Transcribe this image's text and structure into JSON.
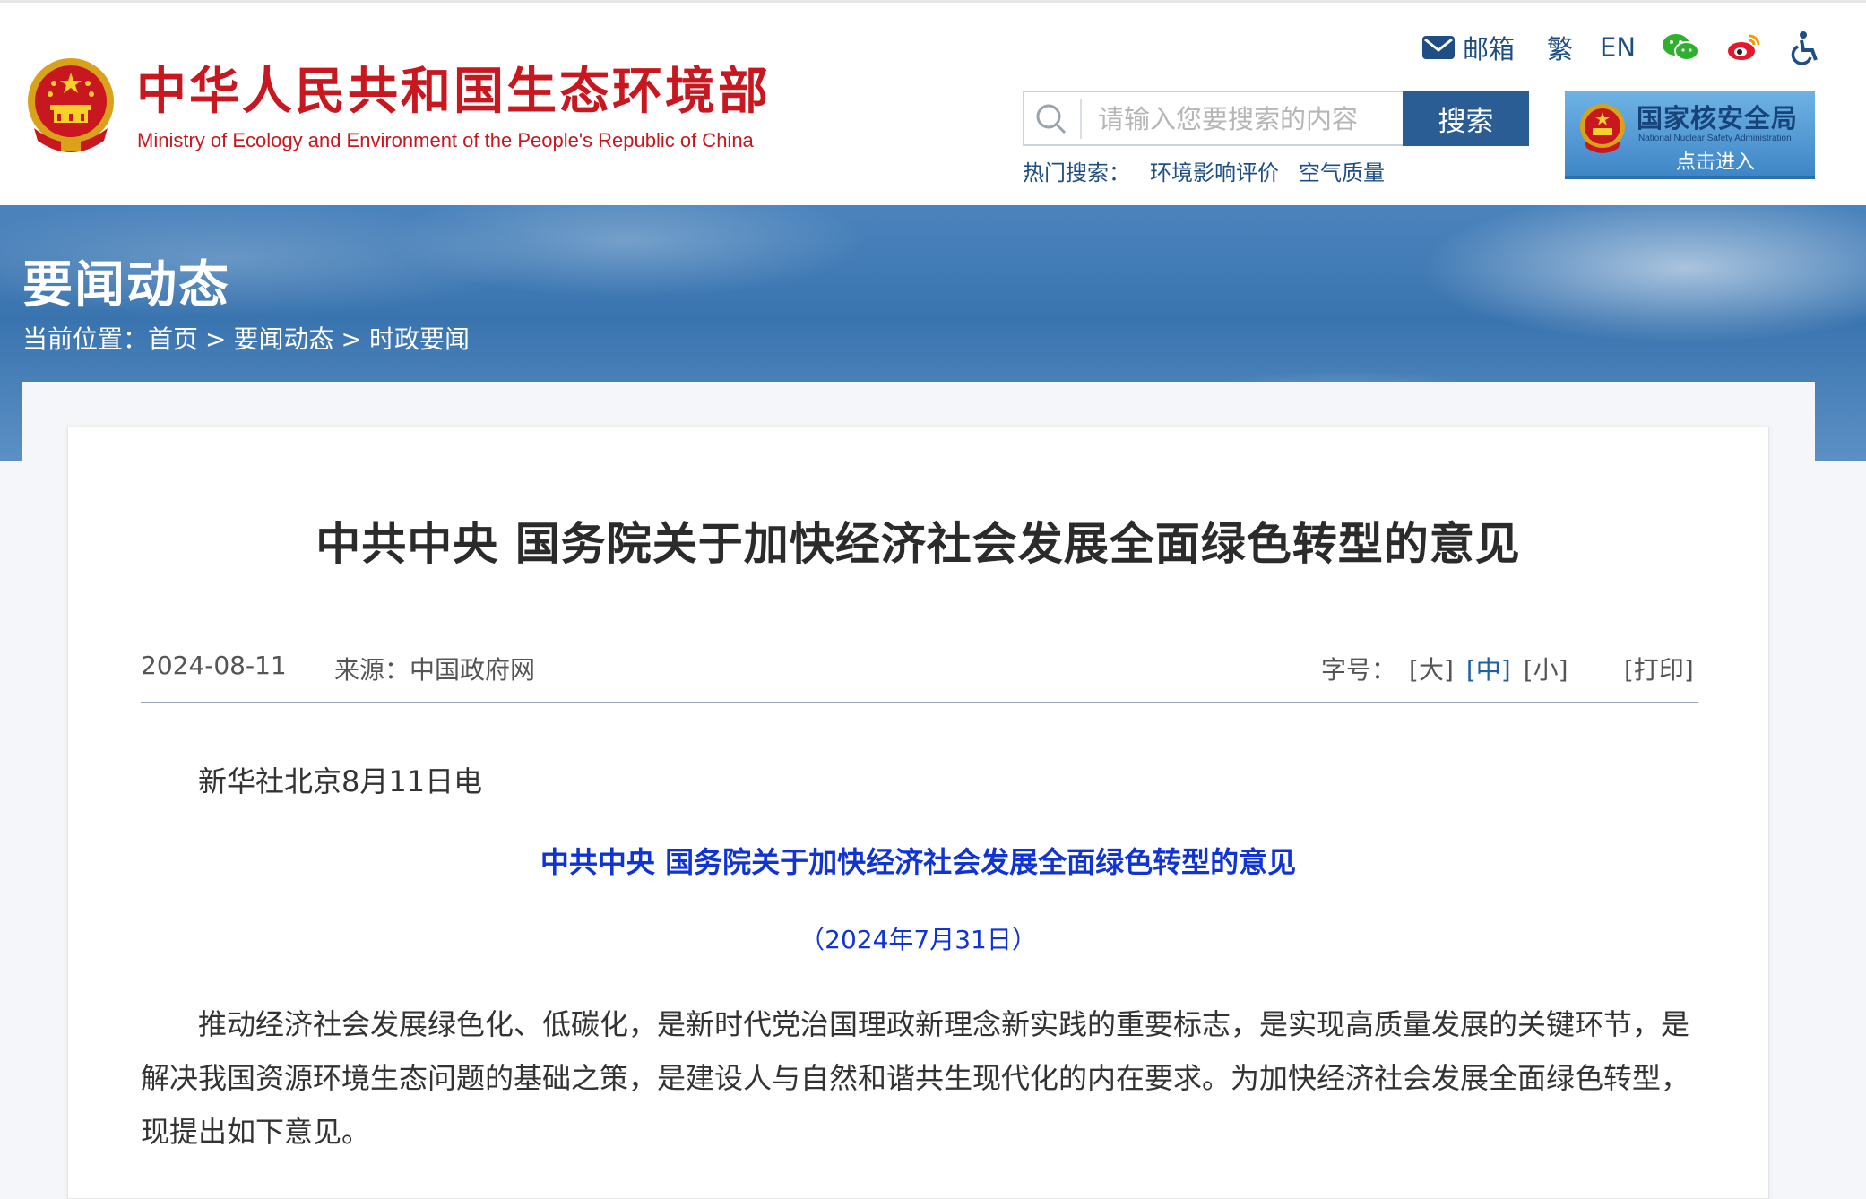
{
  "header": {
    "site_title": "中华人民共和国生态环境部",
    "site_subtitle": "Ministry of Ecology and Environment of the People's Republic of China",
    "links": {
      "mail_label": "邮箱",
      "traditional_label": "繁",
      "english_label": "EN"
    },
    "search": {
      "placeholder": "请输入您要搜索的内容",
      "button_label": "搜索",
      "hot_label": "热门搜索：",
      "hot_terms": [
        "环境影响评价",
        "空气质量"
      ]
    },
    "nnsa_banner": {
      "title": "国家核安全局",
      "subtitle_en": "National Nuclear Safety Administration",
      "enter_label": "点击进入"
    }
  },
  "banner": {
    "title": "要闻动态",
    "breadcrumb_prefix": "当前位置：",
    "crumbs": [
      "首页",
      "要闻动态",
      "时政要闻"
    ],
    "separator": ">"
  },
  "article": {
    "title": "中共中央 国务院关于加快经济社会发展全面绿色转型的意见",
    "date": "2024-08-11",
    "source": "来源：中国政府网",
    "font_size_label": "字号：",
    "font_sizes": [
      "[大]",
      "[中]",
      "[小]"
    ],
    "print_label": "[打印]",
    "dateline": "新华社北京8月11日电",
    "doc_title": "中共中央  国务院关于加快经济社会发展全面绿色转型的意见",
    "doc_date": "（2024年7月31日）",
    "paragraph": "推动经济社会发展绿色化、低碳化，是新时代党治国理政新理念新实践的重要标志，是实现高质量发展的关键环节，是解决我国资源环境生态问题的基础之策，是建设人与自然和谐共生现代化的内在要求。为加快经济社会发展全面绿色转型，现提出如下意见。"
  },
  "colors": {
    "brand_red": "#c8171e",
    "nav_blue": "#1f4e84",
    "doc_blue": "#1033d6",
    "active_font_size": "#1f5fa8"
  }
}
